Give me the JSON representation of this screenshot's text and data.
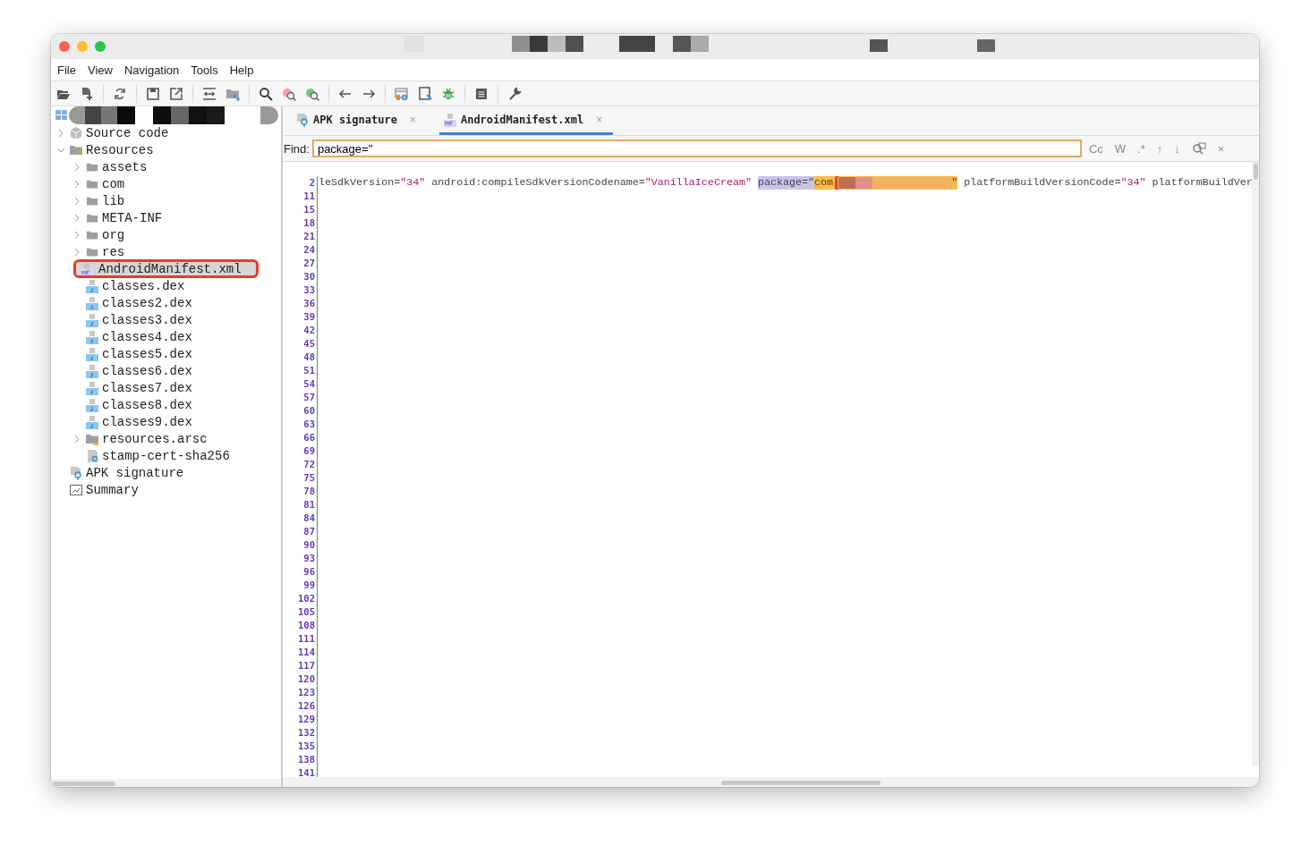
{
  "window": {
    "title_redacted": true
  },
  "menu": [
    "File",
    "View",
    "Navigation",
    "Tools",
    "Help"
  ],
  "sidebar": {
    "header_redacted": true,
    "tree": [
      {
        "label": "Source code",
        "kind": "source",
        "expanded": false,
        "selected": false
      },
      {
        "label": "Resources",
        "kind": "resources",
        "expanded": true,
        "selected": false,
        "children": [
          {
            "label": "assets",
            "kind": "folder",
            "expanded": false,
            "selected": false
          },
          {
            "label": "com",
            "kind": "folder",
            "expanded": false,
            "selected": false
          },
          {
            "label": "lib",
            "kind": "folder",
            "expanded": false,
            "selected": false
          },
          {
            "label": "META-INF",
            "kind": "folder",
            "expanded": false,
            "selected": false
          },
          {
            "label": "org",
            "kind": "folder",
            "expanded": false,
            "selected": false
          },
          {
            "label": "res",
            "kind": "folder",
            "expanded": false,
            "selected": false
          },
          {
            "label": "AndroidManifest.xml",
            "kind": "manifest",
            "selected": true,
            "marked": true
          },
          {
            "label": "classes.dex",
            "kind": "dex",
            "selected": false
          },
          {
            "label": "classes2.dex",
            "kind": "dex",
            "selected": false
          },
          {
            "label": "classes3.dex",
            "kind": "dex",
            "selected": false
          },
          {
            "label": "classes4.dex",
            "kind": "dex",
            "selected": false
          },
          {
            "label": "classes5.dex",
            "kind": "dex",
            "selected": false
          },
          {
            "label": "classes6.dex",
            "kind": "dex",
            "selected": false
          },
          {
            "label": "classes7.dex",
            "kind": "dex",
            "selected": false
          },
          {
            "label": "classes8.dex",
            "kind": "dex",
            "selected": false
          },
          {
            "label": "classes9.dex",
            "kind": "dex",
            "selected": false
          },
          {
            "label": "resources.arsc",
            "kind": "arsc",
            "expanded": false,
            "selected": false
          },
          {
            "label": "stamp-cert-sha256",
            "kind": "cert",
            "selected": false
          }
        ]
      },
      {
        "label": "APK signature",
        "kind": "signature",
        "selected": false
      },
      {
        "label": "Summary",
        "kind": "summary",
        "selected": false
      }
    ]
  },
  "tabs": [
    {
      "label": "APK signature",
      "kind": "signature",
      "selected": false,
      "close": "×"
    },
    {
      "label": "AndroidManifest.xml",
      "kind": "manifest",
      "selected": true,
      "close": "×"
    }
  ],
  "find": {
    "label": "Find:",
    "value": "package=\"",
    "options": [
      "Cc",
      "W",
      ".*",
      "↑",
      "↓"
    ],
    "close": "×"
  },
  "editor": {
    "line_numbers": [
      "2",
      "11",
      "15",
      "18",
      "21",
      "24",
      "27",
      "30",
      "33",
      "36",
      "39",
      "42",
      "45",
      "48",
      "51",
      "54",
      "57",
      "60",
      "63",
      "66",
      "69",
      "72",
      "75",
      "78",
      "81",
      "84",
      "87",
      "90",
      "93",
      "96",
      "99",
      "102",
      "105",
      "108",
      "111",
      "114",
      "117",
      "120",
      "123",
      "126",
      "129",
      "132",
      "135",
      "138",
      "141"
    ],
    "code_line": [
      {
        "text": "leSdkVersion=",
        "kind": "plain"
      },
      {
        "text": "\"34\"",
        "kind": "string"
      },
      {
        "text": " android:compileSdkVersionCodename=",
        "kind": "plain"
      },
      {
        "text": "\"VanillaIceCream\"",
        "kind": "string"
      },
      {
        "text": "package=\"",
        "kind": "search-hit"
      },
      {
        "text": "com",
        "kind": "match"
      },
      {
        "kind": "redacted",
        "marked": true
      },
      {
        "text": "\"",
        "kind": "match"
      },
      {
        "text": " platformBuildVersionCode=",
        "kind": "plain"
      },
      {
        "text": "\"34\"",
        "kind": "string"
      },
      {
        "text": " platformBuildVer",
        "kind": "plain"
      }
    ]
  }
}
